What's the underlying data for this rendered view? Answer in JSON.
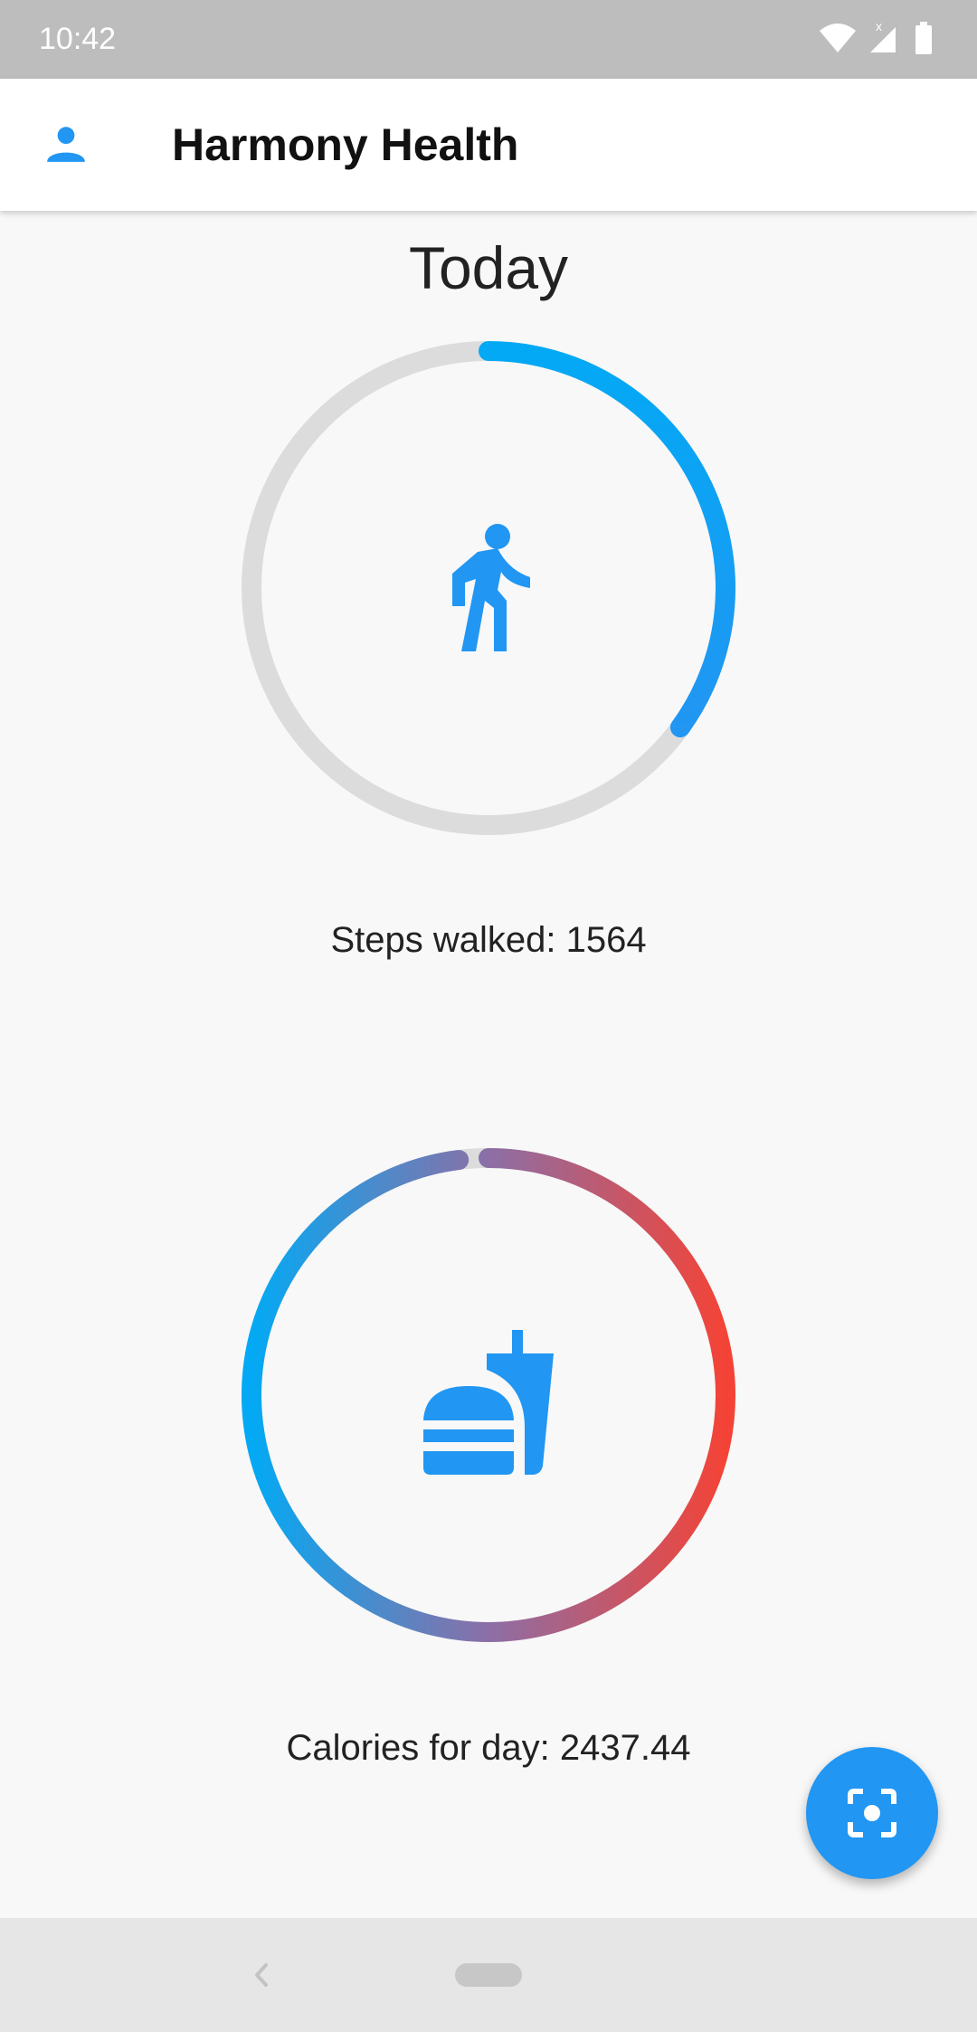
{
  "status_bar": {
    "time": "10:42"
  },
  "app_bar": {
    "title": "Harmony Health",
    "icon": "account-icon"
  },
  "content": {
    "heading": "Today",
    "steps": {
      "label": "Steps walked: 1564",
      "progress_fraction": 0.35,
      "icon": "walk-icon",
      "color": "#1f97f0",
      "track_color": "#dcdcdc"
    },
    "calories": {
      "label": "Calories for day: 2437.44",
      "progress_fraction": 0.98,
      "icon": "fastfood-icon",
      "gradient_colors": [
        "#03a9f4",
        "#f44336"
      ],
      "track_color": "#dcdcdc"
    }
  },
  "fab": {
    "icon": "scan-focus-icon",
    "color": "#2196f3"
  },
  "nav_bar": {
    "back_icon": "back-chevron-icon",
    "home_icon": "home-pill-icon"
  }
}
